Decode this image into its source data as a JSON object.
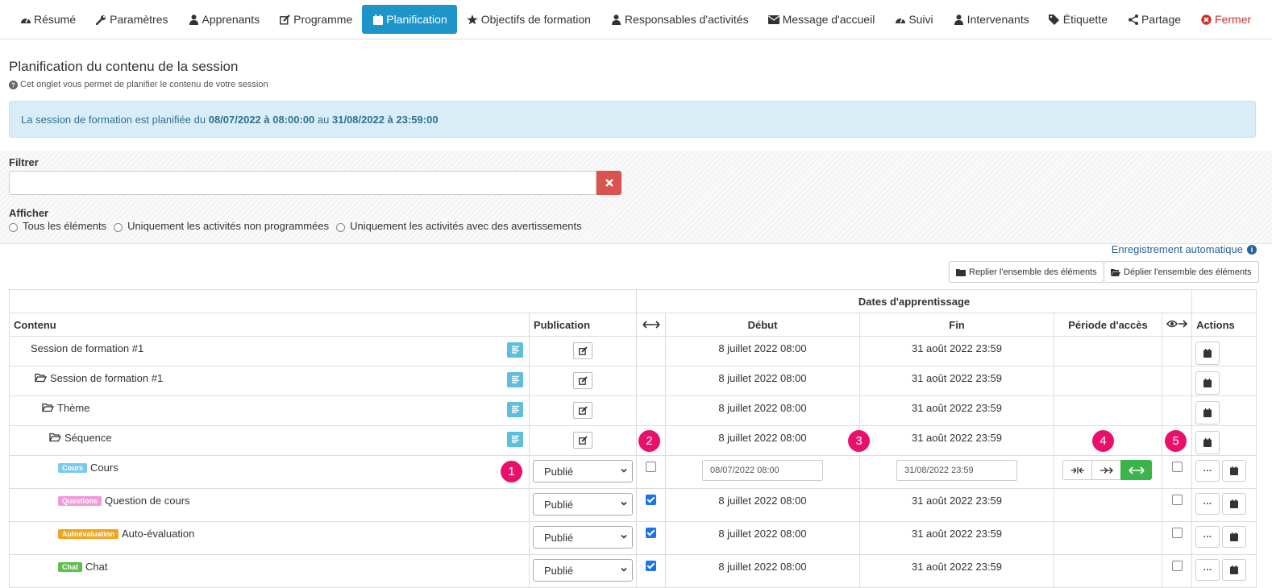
{
  "nav": {
    "tabs": [
      {
        "label": "Résumé",
        "icon": "gauge-icon"
      },
      {
        "label": "Paramètres",
        "icon": "wrench-icon"
      },
      {
        "label": "Apprenants",
        "icon": "user-icon"
      },
      {
        "label": "Programme",
        "icon": "edit-icon"
      },
      {
        "label": "Planification",
        "icon": "calendar-icon"
      },
      {
        "label": "Objectifs de formation",
        "icon": "star-icon"
      },
      {
        "label": "Responsables d'activités",
        "icon": "user-icon"
      },
      {
        "label": "Message d'accueil",
        "icon": "envelope-icon"
      },
      {
        "label": "Suivi",
        "icon": "gauge-icon"
      },
      {
        "label": "Intervenants",
        "icon": "user-icon"
      },
      {
        "label": "Étiquette",
        "icon": "tags-icon"
      },
      {
        "label": "Partage",
        "icon": "share-icon"
      },
      {
        "label": "Fermer",
        "icon": "close-circle-icon"
      }
    ],
    "active_color": "#1d95c9"
  },
  "header": {
    "title": "Planification du contenu de la session",
    "help": "Cet onglet vous permet de planifier le contenu de votre session"
  },
  "alert": {
    "prefix": "La session de formation est planifiée du",
    "start": "08/07/2022 à 08:00:00",
    "middle": "au",
    "end": "31/08/2022 à 23:59:00"
  },
  "filter": {
    "label": "Filtrer",
    "value": "",
    "show_label": "Afficher",
    "options": [
      "Tous les éléments",
      "Uniquement les activités non programmées",
      "Uniquement les activités avec des avertissements"
    ]
  },
  "toolbar": {
    "autosave": "Enregistrement automatique",
    "collapse_all": "Replier l'ensemble des éléments",
    "expand_all": "Déplier l'ensemble des éléments"
  },
  "table": {
    "group_header": "Dates d'apprentissage",
    "col_content": "Contenu",
    "col_publication": "Publication",
    "col_start": "Début",
    "col_end": "Fin",
    "col_period": "Période d'accès",
    "col_actions": "Actions",
    "rows": [
      {
        "name": "Session de formation #1",
        "start": "8 juillet 2022 08:00",
        "end": "31 août 2022 23:59"
      },
      {
        "name": "Session de formation #1",
        "start": "8 juillet 2022 08:00",
        "end": "31 août 2022 23:59"
      },
      {
        "name": "Thème",
        "start": "8 juillet 2022 08:00",
        "end": "31 août 2022 23:59"
      },
      {
        "name": "Séquence",
        "start": "8 juillet 2022 08:00",
        "end": "31 août 2022 23:59"
      }
    ],
    "activities": [
      {
        "badge": "Cours",
        "badge_color": "#7cc8ef",
        "name": "Cours",
        "publication": "Publié",
        "start_input": "08/07/2022 08:00",
        "end_input": "31/08/2022 23:59"
      },
      {
        "badge": "Questions",
        "badge_color": "#f29ad8",
        "name": "Question de cours",
        "publication": "Publié",
        "start": "8 juillet 2022 08:00",
        "end": "31 août 2022 23:59"
      },
      {
        "badge": "Autoévaluation",
        "badge_color": "#f0a51c",
        "name": "Auto-évaluation",
        "publication": "Publié",
        "start": "8 juillet 2022 08:00",
        "end": "31 août 2022 23:59"
      },
      {
        "badge": "Chat",
        "badge_color": "#5cc04a",
        "name": "Chat",
        "publication": "Publié",
        "start": "8 juillet 2022 08:00",
        "end": "31 août 2022 23:59"
      }
    ]
  },
  "markers": [
    "1",
    "2",
    "3",
    "4",
    "5"
  ]
}
